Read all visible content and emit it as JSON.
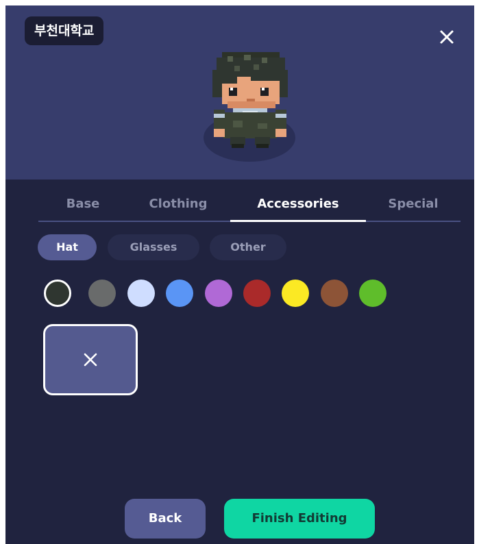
{
  "header": {
    "org_name": "부천대학교",
    "close_icon": "close-icon"
  },
  "avatar": {
    "description_icon": "pixel-character-avatar"
  },
  "tabs": [
    {
      "label": "Base",
      "active": false
    },
    {
      "label": "Clothing",
      "active": false
    },
    {
      "label": "Accessories",
      "active": true
    },
    {
      "label": "Special",
      "active": false
    }
  ],
  "subtabs": [
    {
      "label": "Hat",
      "active": true
    },
    {
      "label": "Glasses",
      "active": false
    },
    {
      "label": "Other",
      "active": false
    }
  ],
  "swatches": [
    {
      "color": "#2f3630",
      "selected": true
    },
    {
      "color": "#696b6b",
      "selected": false
    },
    {
      "color": "#cfddff",
      "selected": false
    },
    {
      "color": "#5a95f5",
      "selected": false
    },
    {
      "color": "#b069d6",
      "selected": false
    },
    {
      "color": "#aa2a2a",
      "selected": false
    },
    {
      "color": "#fbe924",
      "selected": false
    },
    {
      "color": "#8d5437",
      "selected": false
    },
    {
      "color": "#5fbd2b",
      "selected": false
    }
  ],
  "items": [
    {
      "icon": "none-icon",
      "selected": true
    }
  ],
  "footer": {
    "back_label": "Back",
    "finish_label": "Finish Editing"
  },
  "colors": {
    "panel_bg": "#20233f",
    "preview_bg": "#373d6c",
    "accent_purple": "#555b93",
    "accent_green": "#0fd6a3"
  }
}
